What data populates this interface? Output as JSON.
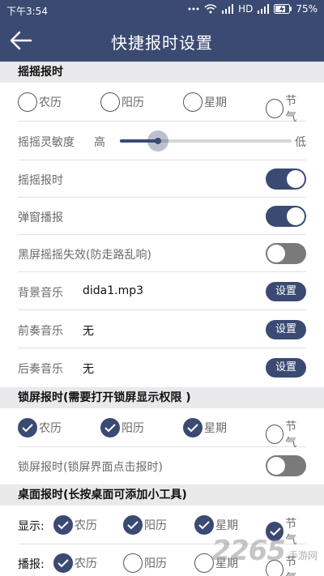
{
  "status_bar": {
    "time": "下午3:54",
    "network": "HD",
    "battery": "75%"
  },
  "app_bar": {
    "title": "快捷报时设置"
  },
  "shake_section": {
    "header": "摇摇报时",
    "options": [
      {
        "label": "农历",
        "checked": false
      },
      {
        "label": "阳历",
        "checked": false
      },
      {
        "label": "星期",
        "checked": false
      },
      {
        "label": "节气",
        "checked": false
      }
    ],
    "sensitivity": {
      "label": "摇摇灵敏度",
      "high_label": "高",
      "low_label": "低",
      "level": 0.22
    },
    "toggles": [
      {
        "label": "摇摇报时",
        "on": true
      },
      {
        "label": "弹窗播报",
        "on": true
      },
      {
        "label": "黑屏摇摇失效(防走路乱响)",
        "on": false
      }
    ],
    "music": [
      {
        "label": "背景音乐",
        "value": "dida1.mp3",
        "button": "设置"
      },
      {
        "label": "前奏音乐",
        "value": "无",
        "button": "设置"
      },
      {
        "label": "后奏音乐",
        "value": "无",
        "button": "设置"
      }
    ]
  },
  "lock_section": {
    "header": "锁屏报时(需要打开锁屏显示权限 )",
    "options": [
      {
        "label": "农历",
        "checked": true
      },
      {
        "label": "阳历",
        "checked": true
      },
      {
        "label": "星期",
        "checked": true
      },
      {
        "label": "节气",
        "checked": false
      }
    ],
    "toggle": {
      "label": "锁屏报时(锁屏界面点击报时)",
      "on": false
    }
  },
  "desktop_section": {
    "header": "桌面报时(长按桌面可添加小工具)",
    "display": {
      "label": "显示:",
      "options": [
        {
          "label": "农历",
          "checked": true
        },
        {
          "label": "阳历",
          "checked": true
        },
        {
          "label": "星期",
          "checked": true
        },
        {
          "label": "节气",
          "checked": true
        }
      ]
    },
    "broadcast": {
      "label": "播报:",
      "options": [
        {
          "label": "农历",
          "checked": true
        },
        {
          "label": "阳历",
          "checked": false
        },
        {
          "label": "星期",
          "checked": false
        },
        {
          "label": "节气",
          "checked": false
        }
      ]
    }
  },
  "watermark": {
    "brand": "2265",
    "site": "手游网"
  },
  "colors": {
    "primary": "#3b4a72",
    "toggle_off": "#7a7a7a",
    "section_bg": "#e9e9ec"
  }
}
